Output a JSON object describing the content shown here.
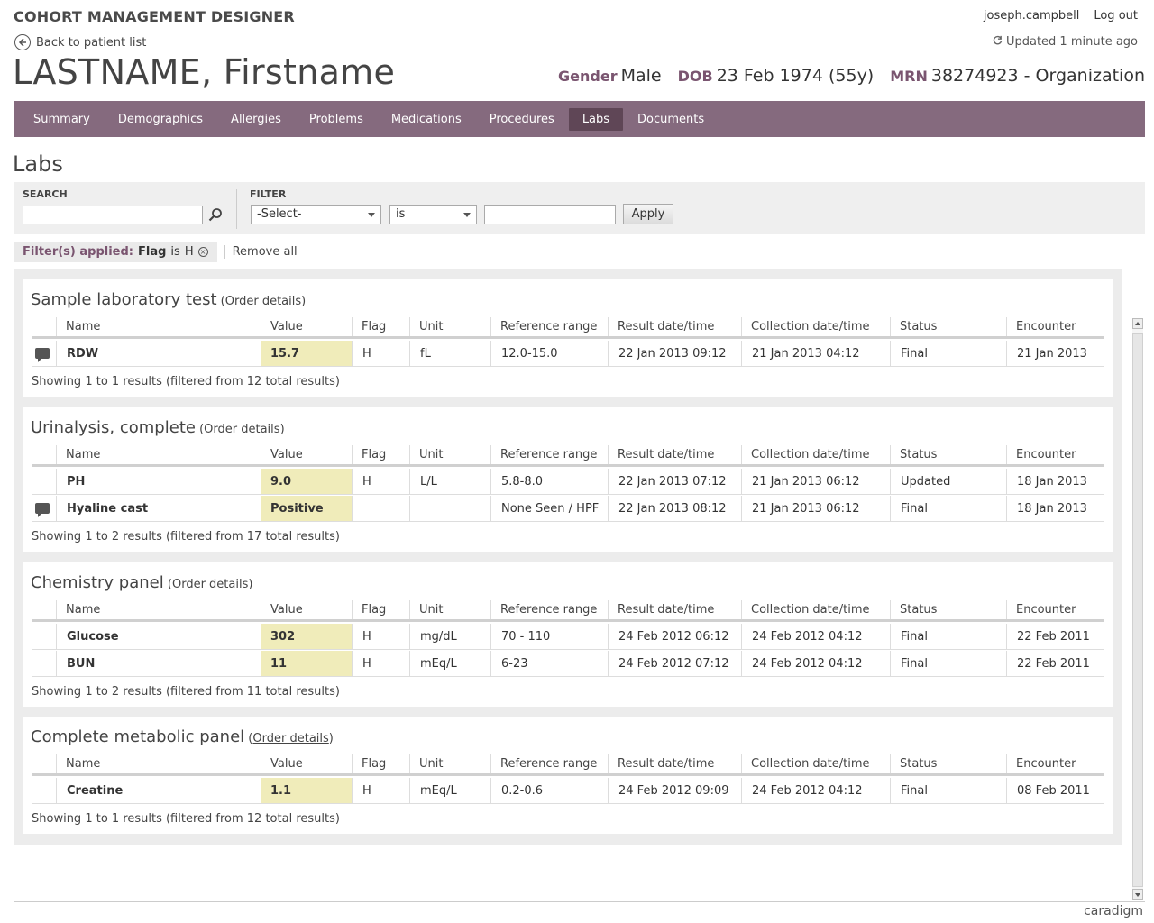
{
  "app": {
    "title": "COHORT MANAGEMENT DESIGNER"
  },
  "user": {
    "name": "joseph.campbell",
    "logout": "Log out"
  },
  "back_link": "Back to patient list",
  "updated": "Updated 1 minute ago",
  "patient": {
    "name": "LASTNAME, Firstname",
    "gender_label": "Gender",
    "gender": "Male",
    "dob_label": "DOB",
    "dob": "23 Feb 1974 (55y)",
    "mrn_label": "MRN",
    "mrn": "38274923 - Organization"
  },
  "tabs": [
    "Summary",
    "Demographics",
    "Allergies",
    "Problems",
    "Medications",
    "Procedures",
    "Labs",
    "Documents"
  ],
  "active_tab": "Labs",
  "section_title": "Labs",
  "search": {
    "label": "SEARCH",
    "value": ""
  },
  "filter": {
    "label": "FILTER",
    "field": "-Select-",
    "operator": "is",
    "value": "",
    "apply": "Apply"
  },
  "filters_applied": {
    "label": "Filter(s) applied:",
    "field": "Flag",
    "op": "is",
    "value": "H",
    "remove_all": "Remove all"
  },
  "columns": [
    "Name",
    "Value",
    "Flag",
    "Unit",
    "Reference range",
    "Result date/time",
    "Collection date/time",
    "Status",
    "Encounter"
  ],
  "panels": [
    {
      "title": "Sample laboratory test",
      "order_details": "Order details",
      "rows": [
        {
          "comment": true,
          "name": "RDW",
          "value": "15.7",
          "flag": "H",
          "unit": "fL",
          "ref": "12.0-15.0",
          "result": "22 Jan 2013  09:12",
          "collection": "21 Jan 2013  04:12",
          "status": "Final",
          "encounter": "21 Jan 2013"
        }
      ],
      "showing": "Showing 1 to 1 results (filtered from 12 total results)"
    },
    {
      "title": "Urinalysis, complete",
      "order_details": "Order details",
      "rows": [
        {
          "comment": false,
          "name": "PH",
          "value": "9.0",
          "flag": "H",
          "unit": "L/L",
          "ref": "5.8-8.0",
          "result": "22 Jan 2013   07:12",
          "collection": "21 Jan 2013  06:12",
          "status": "Updated",
          "encounter": "18 Jan 2013"
        },
        {
          "comment": true,
          "name": "Hyaline cast",
          "value": "Positive",
          "flag": "",
          "unit": "",
          "ref": "None Seen / HPF",
          "result": "22 Jan 2013  08:12",
          "collection": "21 Jan 2013  06:12",
          "status": "Final",
          "encounter": "18 Jan 2013"
        }
      ],
      "showing": "Showing 1 to 2 results (filtered from 17 total results)"
    },
    {
      "title": "Chemistry panel",
      "order_details": "Order details",
      "rows": [
        {
          "comment": false,
          "name": "Glucose",
          "value": "302",
          "flag": "H",
          "unit": "mg/dL",
          "ref": "70 - 110",
          "result": "24 Feb 2012  06:12",
          "collection": "24 Feb 2012  04:12",
          "status": "Final",
          "encounter": "22 Feb 2011"
        },
        {
          "comment": false,
          "name": "BUN",
          "value": "11",
          "flag": "H",
          "unit": "mEq/L",
          "ref": "6-23",
          "result": "24 Feb 2012  07:12",
          "collection": "24 Feb 2012  04:12",
          "status": "Final",
          "encounter": "22 Feb 2011"
        }
      ],
      "showing": "Showing 1 to 2 results (filtered from 11 total results)"
    },
    {
      "title": "Complete metabolic panel",
      "order_details": "Order details",
      "rows": [
        {
          "comment": false,
          "name": "Creatine",
          "value": "1.1",
          "flag": "H",
          "unit": "mEq/L",
          "ref": "0.2-0.6",
          "result": "24 Feb 2012  09:09",
          "collection": "24 Feb 2012  04:12",
          "status": "Final",
          "encounter": "08 Feb 2011"
        }
      ],
      "showing": "Showing 1 to 1 results (filtered from 12 total results)"
    }
  ],
  "brand": "caradigm",
  "colors": {
    "nav": "#856a7e",
    "nav_active": "#5f4656",
    "accent": "#7a5570",
    "value_highlight": "#f0ecba"
  }
}
